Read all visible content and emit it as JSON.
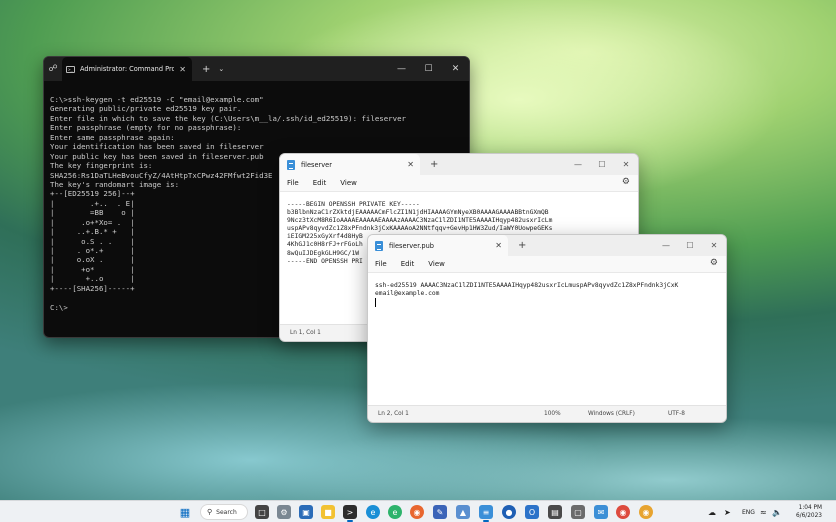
{
  "terminal": {
    "tab_title": "Administrator: Command Pro",
    "lines": [
      "C:\\>ssh-keygen -t ed25519 -C \"email@example.com\"",
      "Generating public/private ed25519 key pair.",
      "Enter file in which to save the key (C:\\Users\\m__la/.ssh/id_ed25519): fileserver",
      "Enter passphrase (empty for no passphrase):",
      "Enter same passphrase again:",
      "Your identification has been saved in fileserver",
      "Your public key has been saved in fileserver.pub",
      "The key fingerprint is:",
      "SHA256:Rs1DaTLHeBvouCfyZ/4AtHtpTxCPwz42FMfwt2Fid3E",
      "The key's randomart image is:",
      "+--[ED25519 256]--+",
      "|        .+..  . E|",
      "|        =BB    o |",
      "|      .o+*Xo= .  |",
      "|     ..+.B.* +   |",
      "|      o.S . .    |",
      "|     . o*.+      |",
      "|     o.oX .      |",
      "|      +o*        |",
      "|       +..o      |",
      "+----[SHA256]-----+",
      "",
      "C:\\>"
    ]
  },
  "notepad_private": {
    "tab_title": "fileserver",
    "menu": [
      "File",
      "Edit",
      "View"
    ],
    "lines": [
      "-----BEGIN OPENSSH PRIVATE KEY-----",
      "b3BlbnNzaC1rZXktdjEAAAAACmFlcZI1N1jdHIAAAAGYmNyeXB0AAAAGAAAABBtnGXmQB",
      "9Ncz3tXcM8R6IoAAAAEAAAAAEAAAAzAAAAC3NzaC1lZDI1NTE5AAAAIHqyp482usxrIcLm",
      "uspAPv8qyvdZc1Z8xPFndnk3jCxKAAAAoA2NNtfqqv+GevHp1HW3Zud/IaWY0UowpeGEKs",
      "iEIGM225xGyXrf4d8HyB",
      "4KhGJ1c0H8rFJ+rFGoLh",
      "8wQuIJDEgkGLH9GC/1W",
      "-----END OPENSSH PRI"
    ],
    "status": {
      "position": "Ln 1, Col 1"
    }
  },
  "notepad_public": {
    "tab_title": "fileserver.pub",
    "menu": [
      "File",
      "Edit",
      "View"
    ],
    "lines": [
      "ssh-ed25519 AAAAC3NzaC1lZDI1NTE5AAAAIHqyp482usxrIcLmuspAPv8qyvdZc1Z8xPFndnk3jCxK",
      "email@example.com"
    ],
    "status": {
      "position": "Ln 2, Col 1",
      "zoom": "100%",
      "line_ending": "Windows (CRLF)",
      "encoding": "UTF-8"
    }
  },
  "taskbar": {
    "search_label": "Search",
    "language": "ENG",
    "time": "1:04 PM",
    "date": "6/6/2023",
    "pinned_icons": [
      "start-icon",
      "search-icon",
      "task-view-icon",
      "settings-icon",
      "file-explorer-icon",
      "store-icon",
      "terminal-icon",
      "edge-icon",
      "edge-dev-icon",
      "firefox-icon",
      "paint-icon",
      "photos-icon",
      "notepad-icon",
      "vpn-icon",
      "outlook-icon",
      "calculator-icon",
      "chrome-icon",
      "chrome-canary-icon"
    ]
  }
}
